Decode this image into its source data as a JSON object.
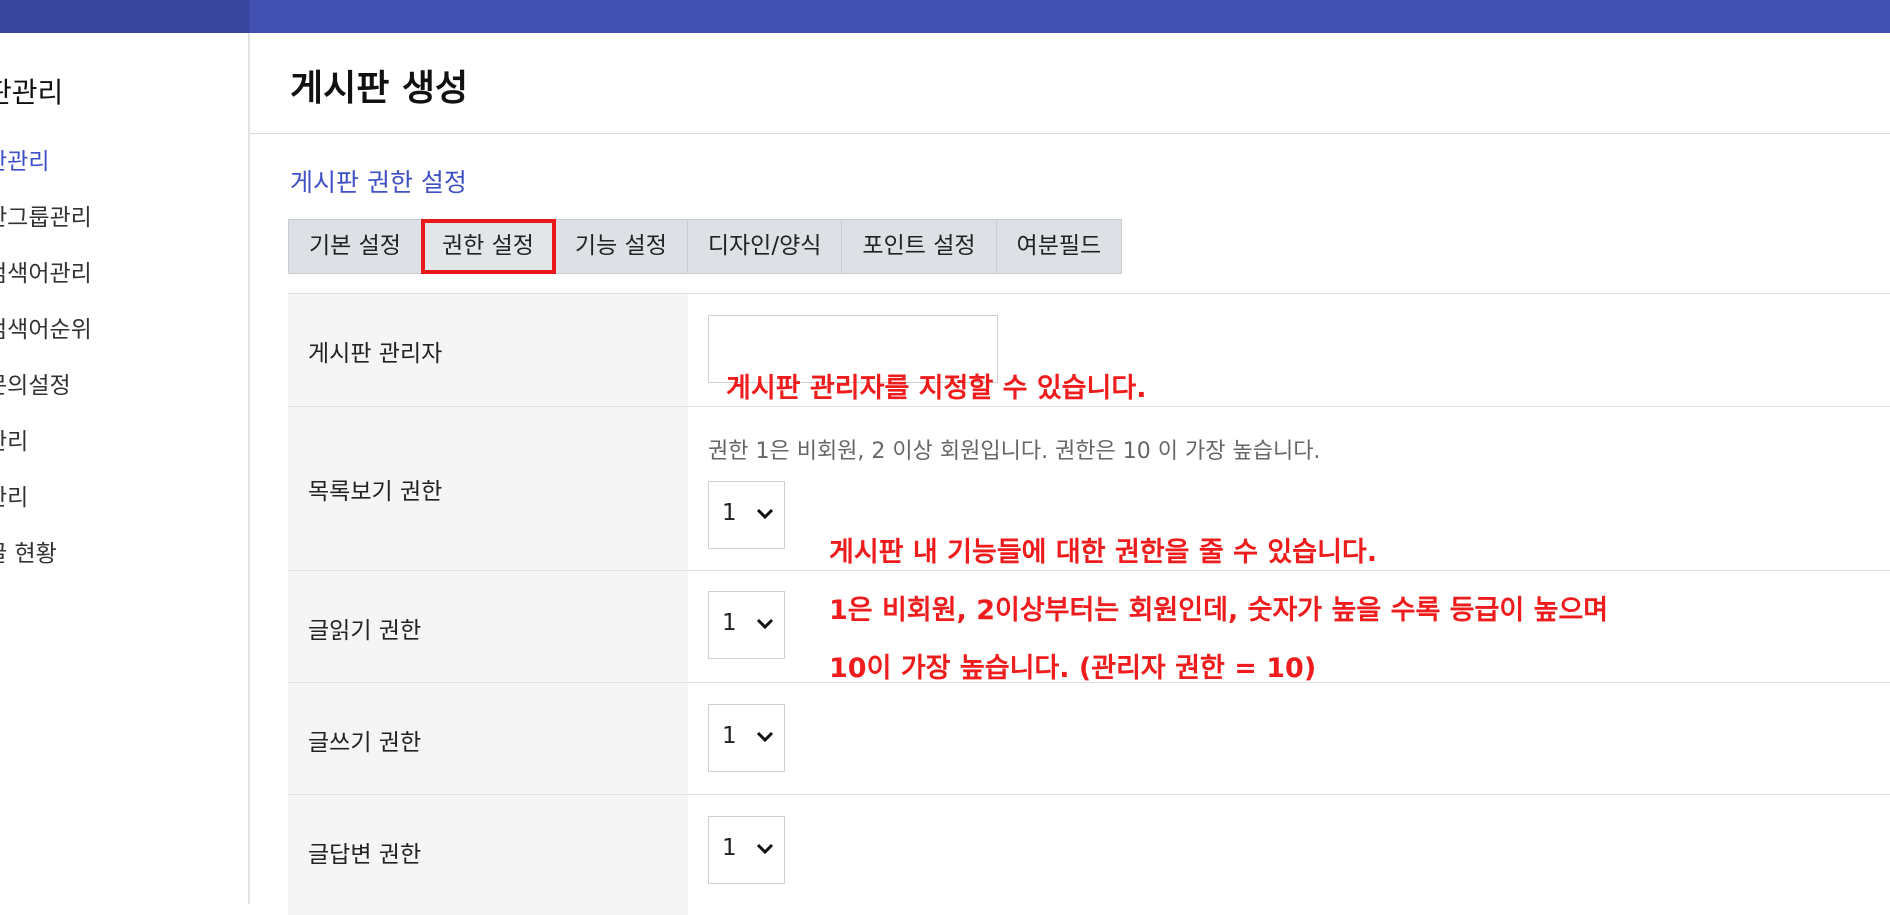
{
  "sidebar": {
    "title": "판관리",
    "items": [
      {
        "label": "판관리",
        "active": true
      },
      {
        "label": "판그룹관리"
      },
      {
        "label": "검색어관리"
      },
      {
        "label": "검색어순위"
      },
      {
        "label": "문의설정"
      },
      {
        "label": "관리"
      },
      {
        "label": "관리"
      },
      {
        "label": "글 현황"
      }
    ]
  },
  "page": {
    "title": "게시판 생성",
    "section_title": "게시판 권한 설정"
  },
  "tabs": [
    {
      "label": "기본 설정"
    },
    {
      "label": "권한 설정",
      "active": true
    },
    {
      "label": "기능 설정"
    },
    {
      "label": "디자인/양식"
    },
    {
      "label": "포인트 설정"
    },
    {
      "label": "여분필드"
    }
  ],
  "form": {
    "admin_label": "게시판 관리자",
    "admin_value": "",
    "help_text": "권한 1은 비회원, 2 이상 회원입니다. 권한은 10 이 가장 높습니다.",
    "rows": [
      {
        "label": "목록보기 권한",
        "value": "1"
      },
      {
        "label": "글읽기 권한",
        "value": "1"
      },
      {
        "label": "글쓰기 권한",
        "value": "1"
      },
      {
        "label": "글답변 권한",
        "value": "1"
      }
    ]
  },
  "annotations": {
    "admin_note": "게시판 관리자를 지정할 수 있습니다.",
    "level_lines": [
      "게시판 내 기능들에 대한 권한을 줄 수 있습니다.",
      "1은 비회원, 2이상부터는 회원인데, 숫자가 높을 수록 등급이 높으며",
      "10이 가장 높습니다. (관리자 권한 = 10)"
    ]
  },
  "colors": {
    "topbar": "#4250b1",
    "accent": "#3f51c5",
    "annotation": "#ee1c1c",
    "highlight_box": "#e8181b"
  }
}
